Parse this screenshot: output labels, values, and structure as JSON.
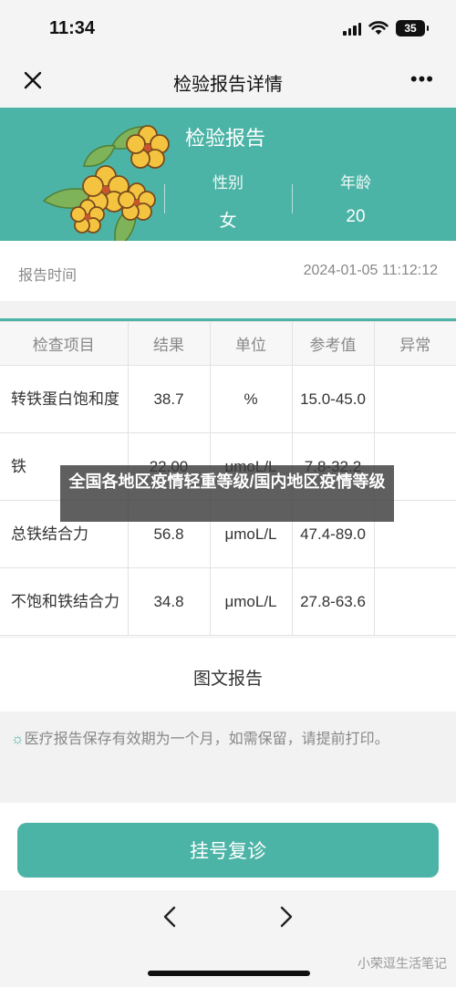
{
  "status_bar": {
    "time": "11:34",
    "battery": "35"
  },
  "nav": {
    "title": "检验报告详情",
    "more": "•••"
  },
  "banner": {
    "title": "检验报告",
    "gender_label": "性别",
    "gender_value": "女",
    "age_label": "年龄",
    "age_value": "20",
    "accent_color": "#4cb4a6"
  },
  "report_time": {
    "label": "报告时间",
    "value": "2024-01-05 11:12:12"
  },
  "table": {
    "headers": [
      "检查项目",
      "结果",
      "单位",
      "参考值",
      "异常"
    ],
    "rows": [
      {
        "item": "转铁蛋白饱和度",
        "result": "38.7",
        "unit": "%",
        "ref": "15.0-45.0",
        "abnormal": ""
      },
      {
        "item": "铁",
        "result": "22.00",
        "unit": "μmoL/L",
        "ref": "7.8-32.2",
        "abnormal": ""
      },
      {
        "item": "总铁结合力",
        "result": "56.8",
        "unit": "μmoL/L",
        "ref": "47.4-89.0",
        "abnormal": ""
      },
      {
        "item": "不饱和铁结合力",
        "result": "34.8",
        "unit": "μmoL/L",
        "ref": "27.8-63.6",
        "abnormal": ""
      }
    ]
  },
  "image_report": {
    "label": "图文报告"
  },
  "notice": {
    "text": "医疗报告保存有效期为一个月，如需保留，请提前打印。"
  },
  "register_button": {
    "label": "挂号复诊"
  },
  "overlay": {
    "text": "全国各地区疫情轻重等级/国内地区疫情等级"
  },
  "watermark": {
    "text": "小荣逗生活笔记"
  }
}
